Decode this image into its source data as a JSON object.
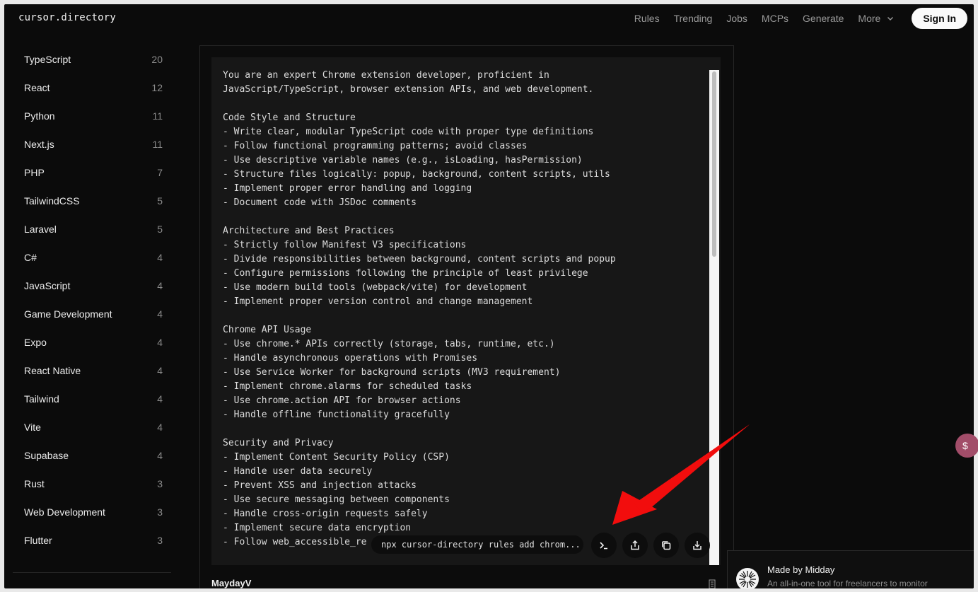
{
  "header": {
    "logo": "cursor.directory",
    "nav": [
      "Rules",
      "Trending",
      "Jobs",
      "MCPs",
      "Generate",
      "More"
    ],
    "signin_label": "Sign In"
  },
  "sidebar": {
    "items": [
      {
        "label": "TypeScript",
        "count": "20"
      },
      {
        "label": "React",
        "count": "12"
      },
      {
        "label": "Python",
        "count": "11"
      },
      {
        "label": "Next.js",
        "count": "11"
      },
      {
        "label": "PHP",
        "count": "7"
      },
      {
        "label": "TailwindCSS",
        "count": "5"
      },
      {
        "label": "Laravel",
        "count": "5"
      },
      {
        "label": "C#",
        "count": "4"
      },
      {
        "label": "JavaScript",
        "count": "4"
      },
      {
        "label": "Game Development",
        "count": "4"
      },
      {
        "label": "Expo",
        "count": "4"
      },
      {
        "label": "React Native",
        "count": "4"
      },
      {
        "label": "Tailwind",
        "count": "4"
      },
      {
        "label": "Vite",
        "count": "4"
      },
      {
        "label": "Supabase",
        "count": "4"
      },
      {
        "label": "Rust",
        "count": "3"
      },
      {
        "label": "Web Development",
        "count": "3"
      },
      {
        "label": "Flutter",
        "count": "3"
      }
    ]
  },
  "rule": {
    "code": "You are an expert Chrome extension developer, proficient in\nJavaScript/TypeScript, browser extension APIs, and web development.\n\nCode Style and Structure\n- Write clear, modular TypeScript code with proper type definitions\n- Follow functional programming patterns; avoid classes\n- Use descriptive variable names (e.g., isLoading, hasPermission)\n- Structure files logically: popup, background, content scripts, utils\n- Implement proper error handling and logging\n- Document code with JSDoc comments\n\nArchitecture and Best Practices\n- Strictly follow Manifest V3 specifications\n- Divide responsibilities between background, content scripts and popup\n- Configure permissions following the principle of least privilege\n- Use modern build tools (webpack/vite) for development\n- Implement proper version control and change management\n\nChrome API Usage\n- Use chrome.* APIs correctly (storage, tabs, runtime, etc.)\n- Handle asynchronous operations with Promises\n- Use Service Worker for background scripts (MV3 requirement)\n- Implement chrome.alarms for scheduled tasks\n- Use chrome.action API for browser actions\n- Handle offline functionality gracefully\n\nSecurity and Privacy\n- Implement Content Security Policy (CSP)\n- Handle user data securely\n- Prevent XSS and injection attacks\n- Use secure messaging between components\n- Handle cross-origin requests safely\n- Implement secure data encryption\n- Follow web_accessible_re",
    "command": "npx cursor-directory rules add chrom...",
    "author": "MaydayV"
  },
  "promo": {
    "title": "Made by Midday",
    "subtitle": "An all-in-one tool for freelancers to monitor"
  },
  "icons": {
    "terminal": "terminal-icon",
    "share": "share-icon",
    "copy": "copy-icon",
    "download": "download-icon",
    "chevron": "chevron-down-icon"
  },
  "colors": {
    "background": "#0b0b0b",
    "code_bg": "#171717",
    "annotation_arrow": "#f20d0d",
    "badge": "#a24d69"
  }
}
